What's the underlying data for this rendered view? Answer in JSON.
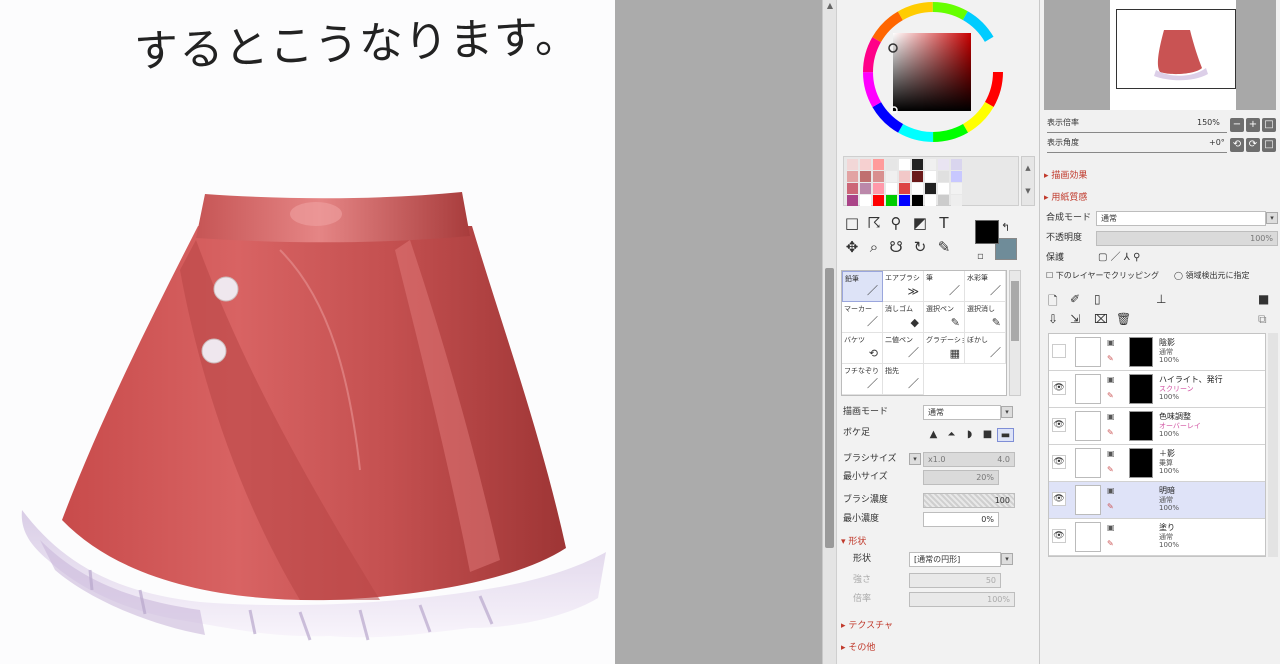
{
  "canvas": {
    "handwriting": "するとこうなります。"
  },
  "color": {
    "fg": "#000000",
    "bg": "#6f8c99"
  },
  "swatches": [
    "#f2d7d7",
    "#f6d0d0",
    "#ff9b9b",
    "#e6e6e6",
    "#ffffff",
    "#222222",
    "#f0f0f0",
    "#e9e4f2",
    "#d9d5ee",
    "#e2a3a3",
    "#c07070",
    "#d99090",
    "#f0f0f0",
    "#f2c8c8",
    "#6a1a1a",
    "#ffffff",
    "#e0e0e0",
    "#c8c8ff",
    "#cc6677",
    "#bb88aa",
    "#ff99aa",
    "#ffffff",
    "#dd4444",
    "#ffffff",
    "#222222",
    "#ffffff",
    "#f2f2f2",
    "#aa4488",
    "#ffffff",
    "#ff0000",
    "#00cc00",
    "#0000ff",
    "#000000",
    "#ffffff",
    "#cccccc",
    "#eeeeee"
  ],
  "brushes": [
    {
      "label": "鉛筆",
      "icon": "／",
      "selected": true
    },
    {
      "label": "エアブラシ",
      "icon": "≫"
    },
    {
      "label": "筆",
      "icon": "／"
    },
    {
      "label": "水彩筆",
      "icon": "／"
    },
    {
      "label": "マーカー",
      "icon": "／"
    },
    {
      "label": "消しゴム",
      "icon": "◆"
    },
    {
      "label": "選択ペン",
      "icon": "✎"
    },
    {
      "label": "選択消し",
      "icon": "✎"
    },
    {
      "label": "バケツ",
      "icon": "⟲"
    },
    {
      "label": "二値ペン",
      "icon": "／"
    },
    {
      "label": "グラデーション",
      "icon": "▦"
    },
    {
      "label": "ぼかし",
      "icon": "／"
    },
    {
      "label": "フチなぞり",
      "icon": "／"
    },
    {
      "label": "指先",
      "icon": "／"
    }
  ],
  "brush_settings": {
    "blend_mode_label": "描画モード",
    "blend_mode_value": "通常",
    "edge_label": "ボケ足",
    "size_label": "ブラシサイズ",
    "size_mult": "x1.0",
    "size_value": "4.0",
    "min_size_label": "最小サイズ",
    "min_size_value": "20%",
    "density_label": "ブラシ濃度",
    "density_value": "100",
    "min_density_label": "最小濃度",
    "min_density_value": "0%",
    "shape_section": "形状",
    "shape_label": "形状",
    "shape_value": "[通常の円形]",
    "shape_sub1_label": "強さ",
    "shape_sub1_value": "50",
    "shape_sub2_label": "倍率",
    "shape_sub2_value": "100%",
    "texture_section": "テクスチャ",
    "other_section": "その他"
  },
  "navigator": {
    "zoom_label": "表示倍率",
    "zoom_value": "150%",
    "angle_label": "表示角度",
    "angle_value": "+0°",
    "zoom_minus": "−",
    "zoom_plus": "+",
    "zoom_fit": "□",
    "rot_ccw": "⟲",
    "rot_cw": "⟳",
    "rot_reset": "□"
  },
  "layer_panel": {
    "section1": "描画効果",
    "section2": "用紙質感",
    "blend_mode_label": "合成モード",
    "blend_mode_value": "通常",
    "opacity_label": "不透明度",
    "opacity_value": "100%",
    "protect_label": "保護",
    "clip_label": "下のレイヤーでクリッピング",
    "select_source_label": "領域検出元に指定"
  },
  "layers": [
    {
      "name": "陰影",
      "mode": "通常",
      "opacity": "100%",
      "visible": false,
      "mask": true,
      "pinkMode": false
    },
    {
      "name": "ハイライト、発行",
      "mode": "スクリーン",
      "opacity": "100%",
      "visible": true,
      "mask": true,
      "pinkMode": true
    },
    {
      "name": "色味調整",
      "mode": "オーバーレイ",
      "opacity": "100%",
      "visible": true,
      "mask": true,
      "pinkMode": true
    },
    {
      "name": "＋影",
      "mode": "乗算",
      "opacity": "100%",
      "visible": true,
      "mask": true,
      "pinkMode": false
    },
    {
      "name": "明暗",
      "mode": "通常",
      "opacity": "100%",
      "visible": true,
      "mask": false,
      "selected": true,
      "pinkMode": false
    },
    {
      "name": "塗り",
      "mode": "通常",
      "opacity": "100%",
      "visible": true,
      "mask": false,
      "pinkMode": false
    }
  ]
}
